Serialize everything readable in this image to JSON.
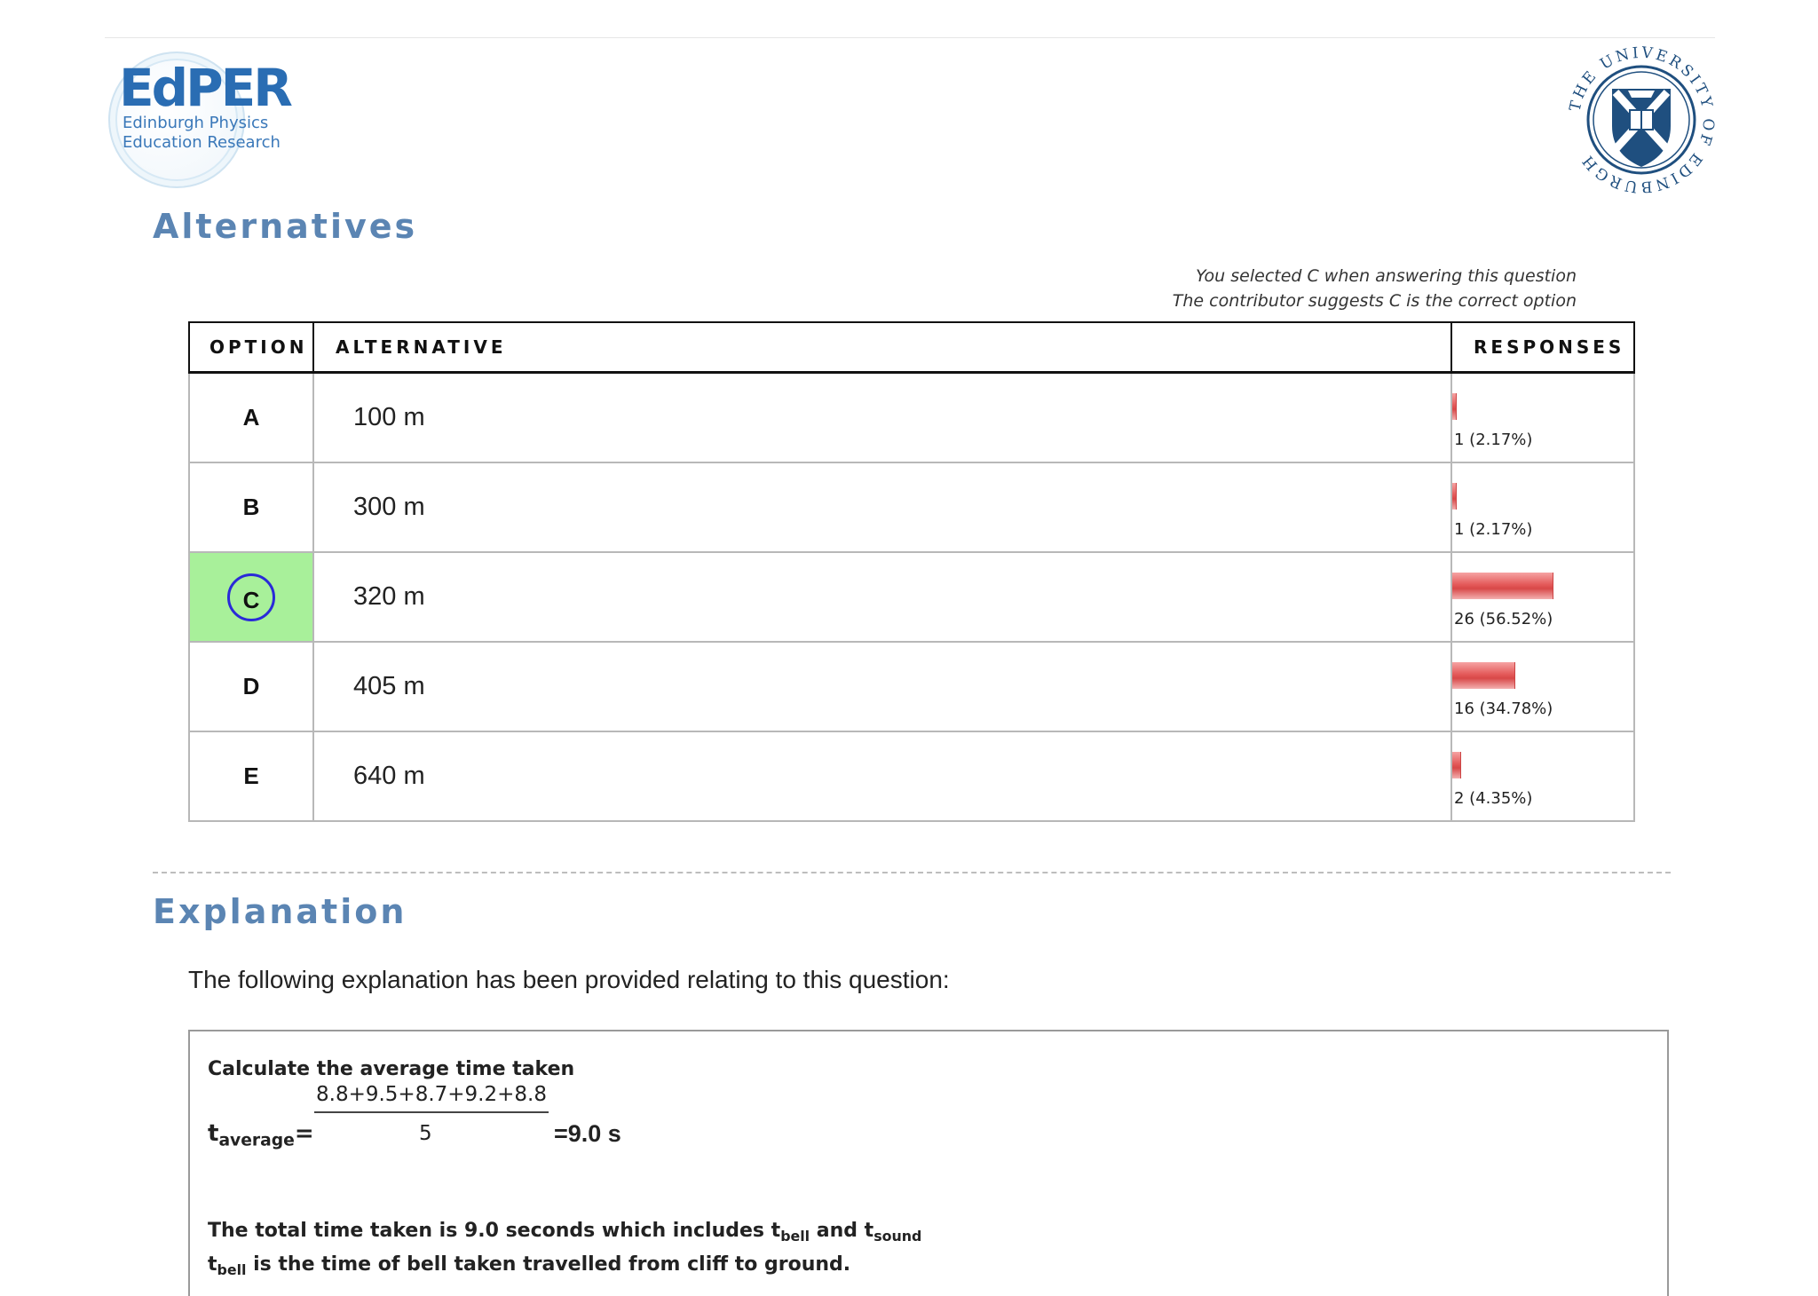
{
  "logo": {
    "brand": "EdPER",
    "line1": "Edinburgh Physics",
    "line2": "Education Research"
  },
  "seal": {
    "text": "THE UNIVERSITY OF EDINBURGH"
  },
  "alternatives": {
    "title": "Alternatives",
    "note_selected": "You selected C when answering this question",
    "note_correct": "The contributor suggests C is the correct option",
    "headers": {
      "option": "OPTION",
      "alternative": "ALTERNATIVE",
      "responses": "RESPONSES"
    },
    "rows": [
      {
        "option": "A",
        "alternative": "100 m",
        "count": 1,
        "percent": 2.17,
        "label": "1 (2.17%)"
      },
      {
        "option": "B",
        "alternative": "300 m",
        "count": 1,
        "percent": 2.17,
        "label": "1 (2.17%)"
      },
      {
        "option": "C",
        "alternative": "320 m",
        "count": 26,
        "percent": 56.52,
        "label": "26 (56.52%)"
      },
      {
        "option": "D",
        "alternative": "405 m",
        "count": 16,
        "percent": 34.78,
        "label": "16 (34.78%)"
      },
      {
        "option": "E",
        "alternative": "640 m",
        "count": 2,
        "percent": 4.35,
        "label": "2 (4.35%)"
      }
    ],
    "correct_option": "C",
    "selected_option": "C",
    "colors": {
      "correct_bg": "#a8f09a",
      "selected_ring": "#2a2ad8",
      "bar": "#e45a5a"
    }
  },
  "explanation": {
    "title": "Explanation",
    "intro": "The following explanation has been provided relating to this question:",
    "heading": "Calculate the average time taken",
    "numerator": "8.8+9.5+8.7+9.2+8.8",
    "denominator": "5",
    "t_symbol": "t",
    "t_sub": "average",
    "equals": "=",
    "result": "=9.0 s",
    "line1_a": "The total time taken is 9.0 seconds which includes t",
    "line1_sub1": "bell",
    "line1_b": " and t",
    "line1_sub2": "sound",
    "line2_sub": "bell",
    "line2_b": " is the time of bell taken travelled from cliff to ground."
  }
}
